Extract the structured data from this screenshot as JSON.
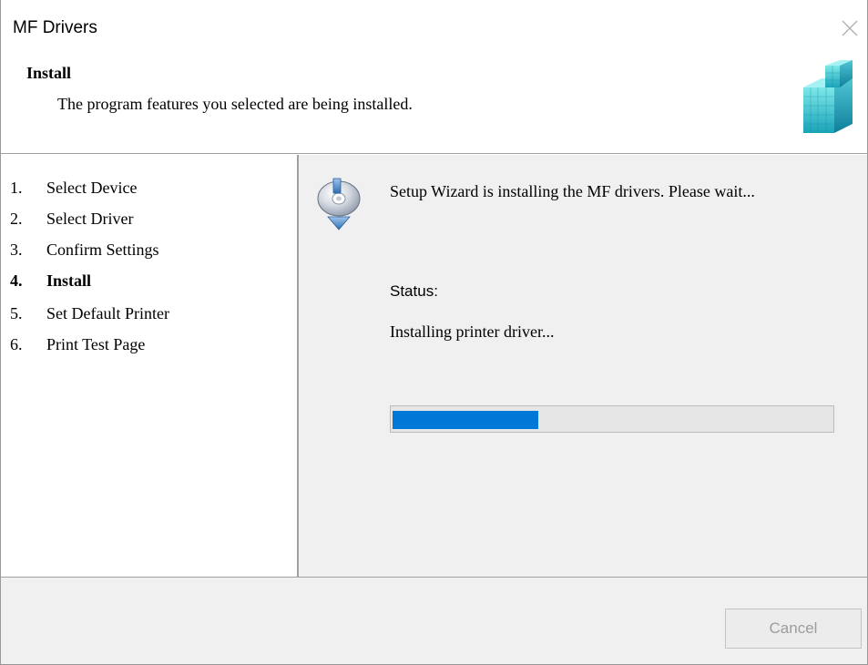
{
  "window": {
    "title": "MF Drivers"
  },
  "header": {
    "title": "Install",
    "subtitle": "The program features you selected are being installed.",
    "logo_icon": "cube-logo-icon"
  },
  "steps": [
    {
      "num": "1.",
      "label": "Select Device",
      "active": false
    },
    {
      "num": "2.",
      "label": "Select Driver",
      "active": false
    },
    {
      "num": "3.",
      "label": "Confirm Settings",
      "active": false
    },
    {
      "num": "4.",
      "label": "Install",
      "active": true
    },
    {
      "num": "5.",
      "label": "Set Default Printer",
      "active": false
    },
    {
      "num": "6.",
      "label": "Print Test Page",
      "active": false
    }
  ],
  "content": {
    "icon": "disc-install-icon",
    "message": "Setup Wizard is installing the MF drivers. Please wait...",
    "status_label": "Status:",
    "status_text": "Installing printer driver...",
    "progress_fraction": 0.33
  },
  "footer": {
    "cancel_label": "Cancel"
  },
  "colors": {
    "accent": "#0078d7",
    "panel_bg": "#f0f0f0",
    "disabled_text": "#9c9c9c"
  }
}
